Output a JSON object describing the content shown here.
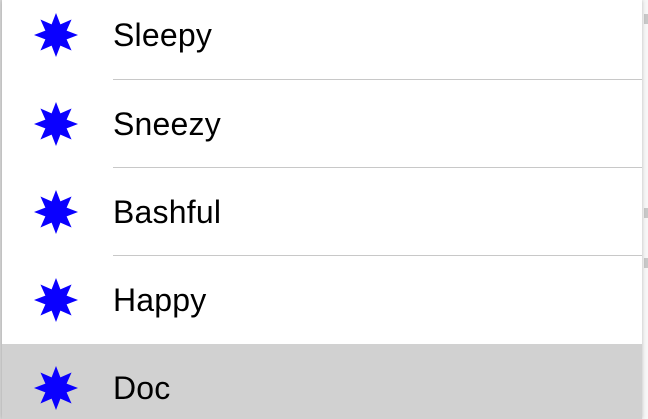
{
  "menu": {
    "items": [
      {
        "label": "Sleepy",
        "icon": "star-burst-icon",
        "selected": false
      },
      {
        "label": "Sneezy",
        "icon": "star-burst-icon",
        "selected": false
      },
      {
        "label": "Bashful",
        "icon": "star-burst-icon",
        "selected": false
      },
      {
        "label": "Happy",
        "icon": "star-burst-icon",
        "selected": false
      },
      {
        "label": "Doc",
        "icon": "star-burst-icon",
        "selected": true
      }
    ]
  },
  "colors": {
    "icon_fill": "#0a00ff",
    "selected_background": "#d1d1d1",
    "divider": "#c8c8c8",
    "text": "#000000"
  }
}
